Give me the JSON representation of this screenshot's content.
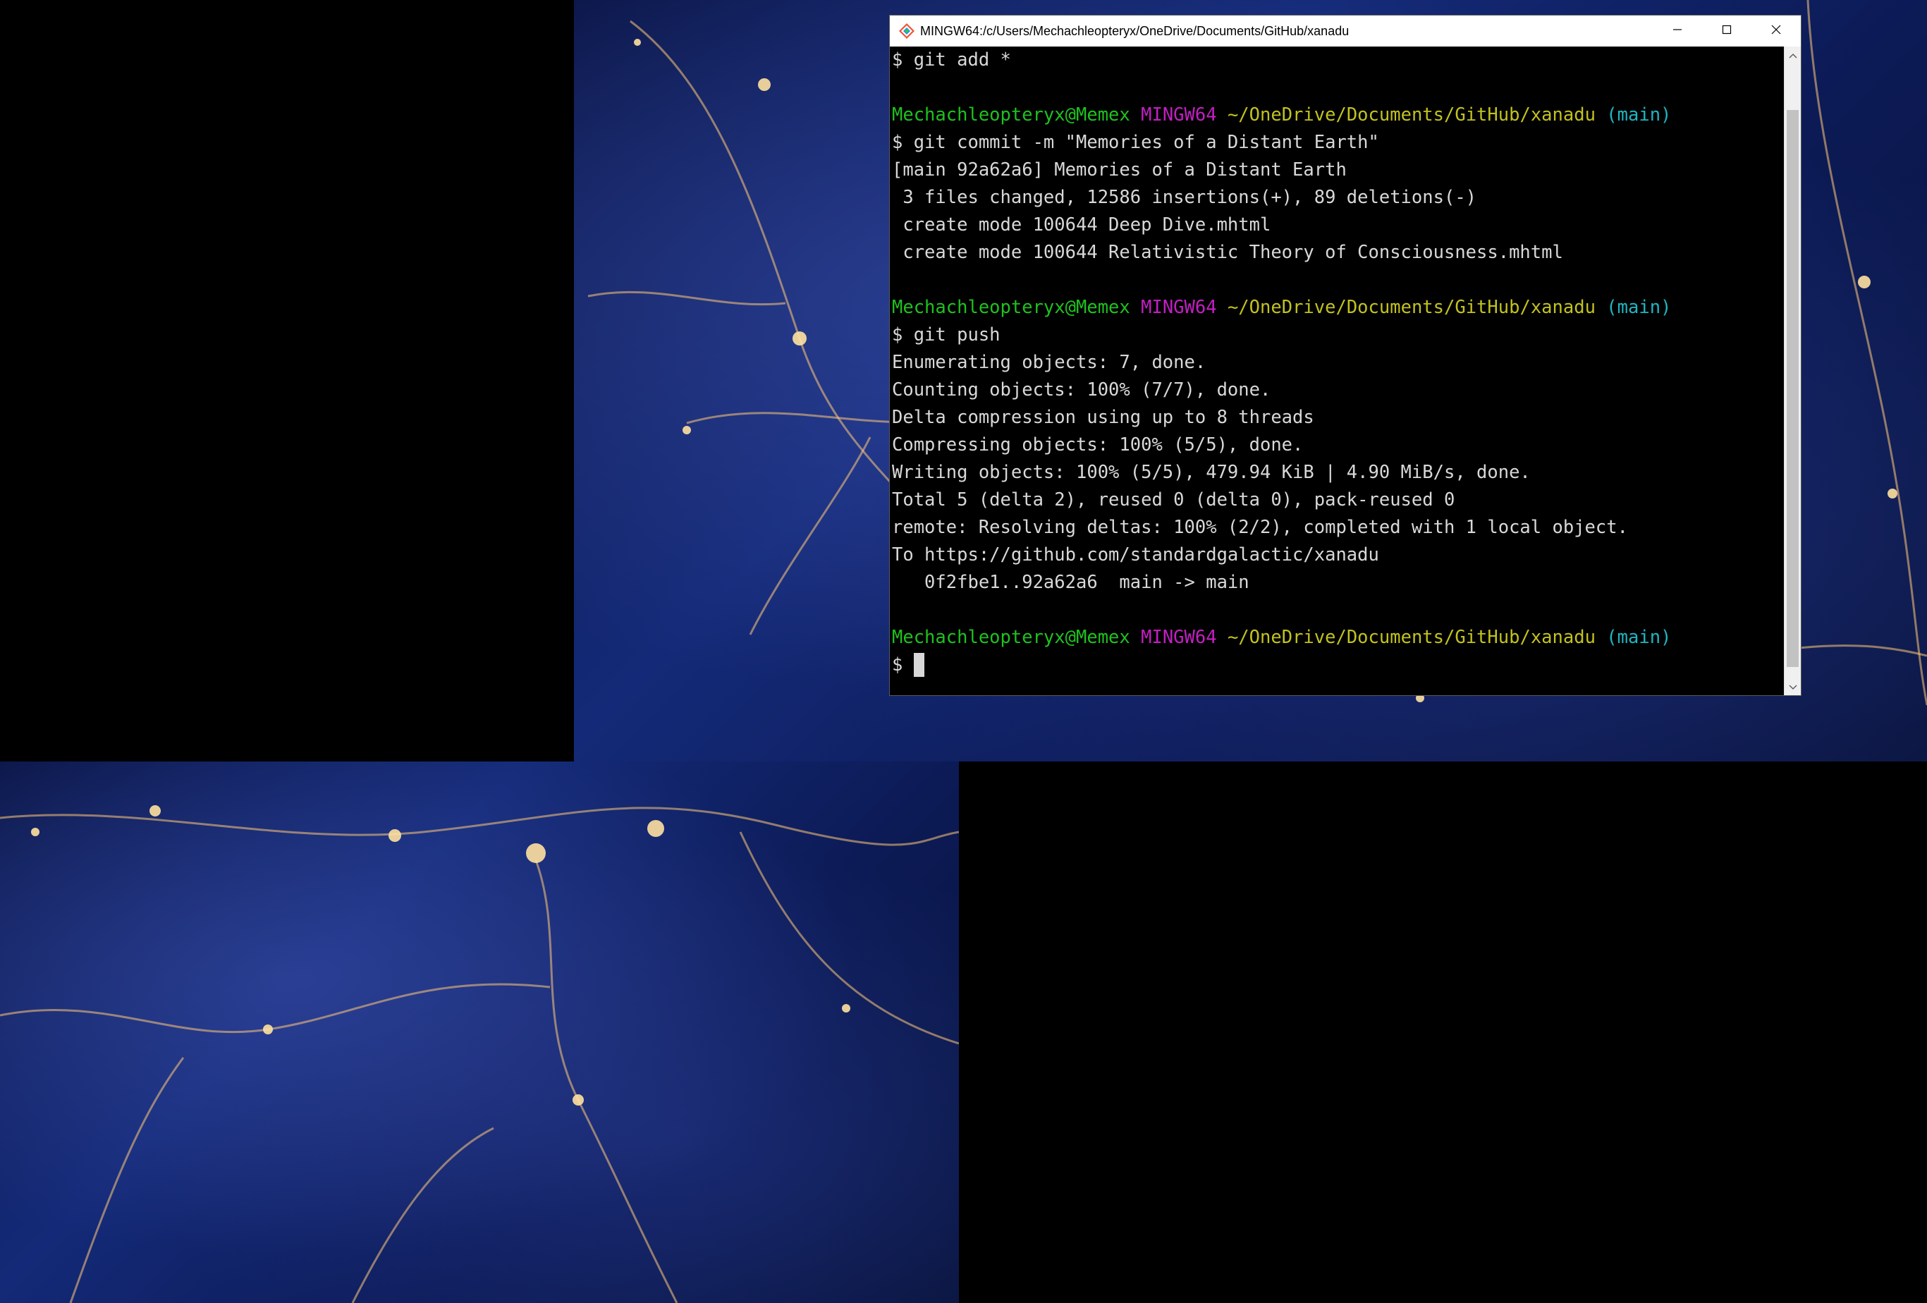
{
  "terminal": {
    "title": "MINGW64:/c/Users/Mechachleopteryx/OneDrive/Documents/GitHub/xanadu",
    "colors": {
      "user": "#1fc11f",
      "system": "#c21fc2",
      "path": "#c2c21f",
      "branch": "#1fb5c2",
      "text": "#d8d8d8"
    },
    "prompts": [
      {
        "user": "Mechachleopteryx@Memex",
        "system": "MINGW64",
        "path": "~/OneDrive/Documents/GitHub/xanadu",
        "branch": "(main)"
      },
      {
        "user": "Mechachleopteryx@Memex",
        "system": "MINGW64",
        "path": "~/OneDrive/Documents/GitHub/xanadu",
        "branch": "(main)"
      },
      {
        "user": "Mechachleopteryx@Memex",
        "system": "MINGW64",
        "path": "~/OneDrive/Documents/GitHub/xanadu",
        "branch": "(main)"
      }
    ],
    "lines": {
      "cmd_add": "$ git add *",
      "cmd_commit": "$ git commit -m \"Memories of a Distant Earth\"",
      "commit_result": "[main 92a62a6] Memories of a Distant Earth",
      "commit_stats": " 3 files changed, 12586 insertions(+), 89 deletions(-)",
      "create_1": " create mode 100644 Deep Dive.mhtml",
      "create_2": " create mode 100644 Relativistic Theory of Consciousness.mhtml",
      "cmd_push": "$ git push",
      "push_1": "Enumerating objects: 7, done.",
      "push_2": "Counting objects: 100% (7/7), done.",
      "push_3": "Delta compression using up to 8 threads",
      "push_4": "Compressing objects: 100% (5/5), done.",
      "push_5": "Writing objects: 100% (5/5), 479.94 KiB | 4.90 MiB/s, done.",
      "push_6": "Total 5 (delta 2), reused 0 (delta 0), pack-reused 0",
      "push_7": "remote: Resolving deltas: 100% (2/2), completed with 1 local object.",
      "push_8": "To https://github.com/standardgalactic/xanadu",
      "push_9": "   0f2fbe1..92a62a6  main -> main",
      "final_prompt": "$ "
    },
    "icons": {
      "app": "git-bash-icon",
      "minimize": "minimize-icon",
      "maximize": "maximize-icon",
      "close": "close-icon",
      "scroll_up": "chevron-up-icon",
      "scroll_down": "chevron-down-icon"
    }
  }
}
